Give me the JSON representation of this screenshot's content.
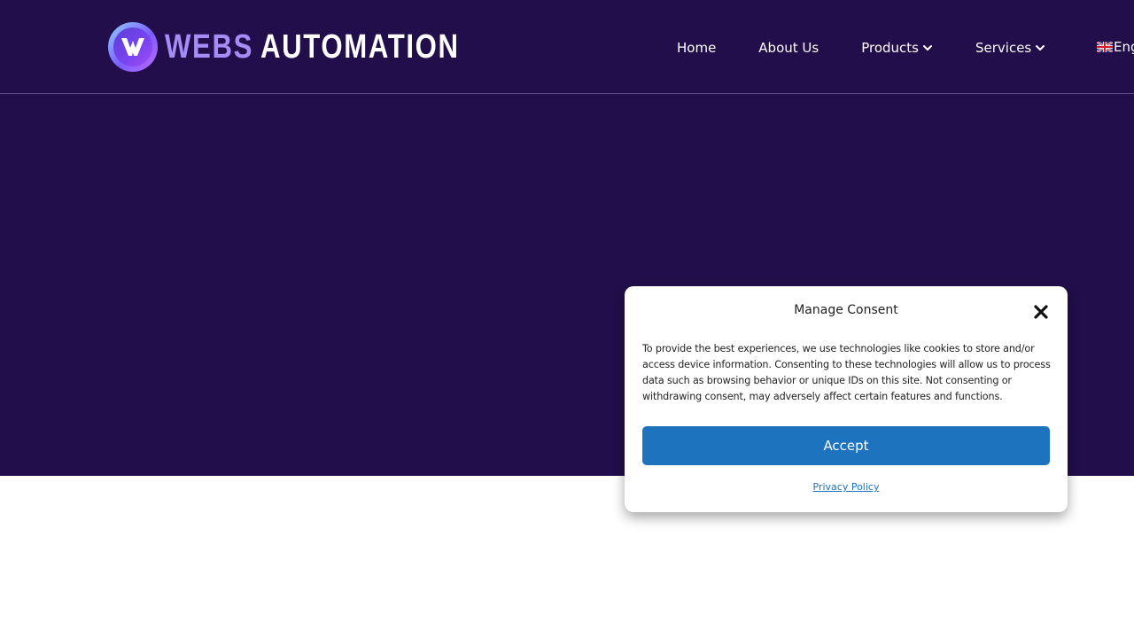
{
  "brand": {
    "logo_text_primary": "WEBS",
    "logo_text_secondary": "AUTOMATION",
    "logo_icon": "wa-monogram-icon"
  },
  "nav": {
    "items": [
      {
        "label": "Home",
        "has_dropdown": false
      },
      {
        "label": "About Us",
        "has_dropdown": false
      },
      {
        "label": "Products",
        "has_dropdown": true
      },
      {
        "label": "Services",
        "has_dropdown": true
      }
    ],
    "language_label": "Eng",
    "language_icon": "uk-flag-icon"
  },
  "consent": {
    "title": "Manage Consent",
    "body": "To provide the best experiences, we use technologies like cookies to store and/or access device information. Consenting to these technologies will allow us to process data such as browsing behavior or unique IDs on this site. Not consenting or withdrawing consent, may adversely affect certain features and functions.",
    "accept_label": "Accept",
    "privacy_label": "Privacy Policy",
    "close_icon": "close-icon"
  },
  "colors": {
    "hero_background": "#220e4a",
    "accent_button": "#1e73be",
    "page_background": "#ffffff"
  }
}
